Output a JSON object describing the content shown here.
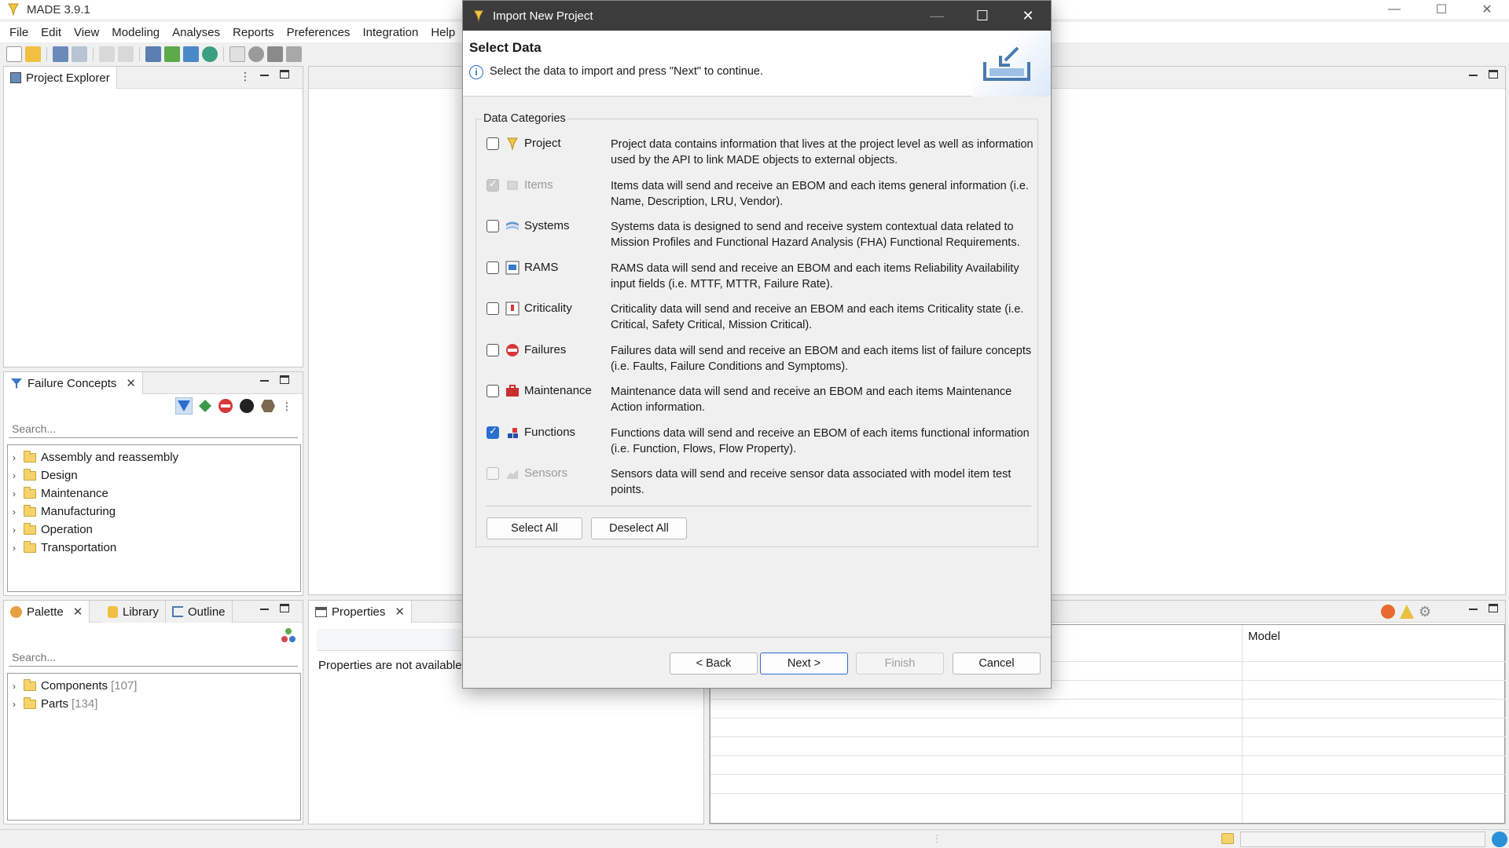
{
  "app": {
    "title": "MADE 3.9.1",
    "window_controls": [
      "—",
      "☐",
      "✕"
    ]
  },
  "menu": [
    "File",
    "Edit",
    "View",
    "Modeling",
    "Analyses",
    "Reports",
    "Preferences",
    "Integration",
    "Help"
  ],
  "project_explorer": {
    "tab_label": "Project Explorer"
  },
  "failure_concepts": {
    "tab_label": "Failure Concepts",
    "search_placeholder": "Search...",
    "folders": [
      "Assembly and reassembly",
      "Design",
      "Maintenance",
      "Manufacturing",
      "Operation",
      "Transportation"
    ]
  },
  "palette": {
    "tab_palette": "Palette",
    "tab_library": "Library",
    "tab_outline": "Outline",
    "search_placeholder": "Search...",
    "items": [
      {
        "label": "Components",
        "count": "[107]"
      },
      {
        "label": "Parts",
        "count": "[134]"
      }
    ]
  },
  "properties": {
    "tab_label": "Properties",
    "message": "Properties are not available"
  },
  "right_table": {
    "column_model": "Model"
  },
  "dialog": {
    "title": "Import New Project",
    "header_title": "Select Data",
    "header_message": "Select the data to import and press \"Next\" to continue.",
    "group_label": "Data Categories",
    "categories": [
      {
        "name": "Project",
        "checked": false,
        "disabled": false,
        "description": "Project data contains information that lives at the project level as well as information used by the API to link MADE objects to external objects.",
        "icon": "project-icon"
      },
      {
        "name": "Items",
        "checked": true,
        "disabled": true,
        "description": "Items data will send and receive an EBOM and each items general information (i.e. Name, Description, LRU, Vendor).",
        "icon": "items-icon"
      },
      {
        "name": "Systems",
        "checked": false,
        "disabled": false,
        "description": "Systems data is designed to send and receive system contextual data related to Mission Profiles and Functional Hazard Analysis (FHA) Functional Requirements.",
        "icon": "systems-icon"
      },
      {
        "name": "RAMS",
        "checked": false,
        "disabled": false,
        "description": "RAMS data will send and receive an EBOM and each items Reliability  Availability input fields (i.e. MTTF, MTTR, Failure Rate).",
        "icon": "rams-icon"
      },
      {
        "name": "Criticality",
        "checked": false,
        "disabled": false,
        "description": "Criticality data will send and receive an EBOM and each items Criticality state (i.e. Critical, Safety Critical, Mission Critical).",
        "icon": "criticality-icon"
      },
      {
        "name": "Failures",
        "checked": false,
        "disabled": false,
        "description": "Failures data will send and receive an EBOM and each items list of failure concepts (i.e. Faults, Failure Conditions and Symptoms).",
        "icon": "failures-icon"
      },
      {
        "name": "Maintenance",
        "checked": false,
        "disabled": false,
        "description": "Maintenance data will send and receive an EBOM and each items Maintenance Action information.",
        "icon": "maintenance-icon"
      },
      {
        "name": "Functions",
        "checked": true,
        "disabled": false,
        "description": "Functions data will send and receive an EBOM of each items functional information (i.e. Function, Flows, Flow Property).",
        "icon": "functions-icon"
      },
      {
        "name": "Sensors",
        "checked": false,
        "disabled": true,
        "description": "Sensors data will send and receive sensor data associated with model item test points.",
        "icon": "sensors-icon"
      }
    ],
    "select_all_label": "Select All",
    "deselect_all_label": "Deselect All",
    "back_label": "< Back",
    "next_label": "Next >",
    "finish_label": "Finish",
    "cancel_label": "Cancel"
  },
  "colors": {
    "accent": "#2a6fcf",
    "dialog_title_bg": "#3c3c3c"
  }
}
